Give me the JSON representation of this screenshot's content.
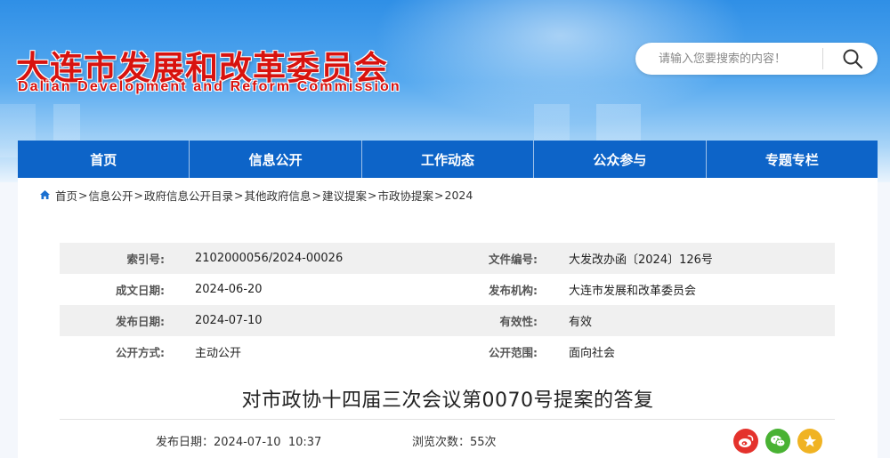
{
  "site": {
    "title_cn": "大连市发展和改革委员会",
    "title_en": "Dalian Development and Reform Commission"
  },
  "search": {
    "placeholder": "请输入您要搜索的内容！",
    "icon": "search-icon"
  },
  "nav": [
    {
      "label": "首页"
    },
    {
      "label": "信息公开"
    },
    {
      "label": "工作动态"
    },
    {
      "label": "公众参与"
    },
    {
      "label": "专题专栏"
    }
  ],
  "breadcrumb": [
    {
      "label": "首页"
    },
    {
      "label": "信息公开"
    },
    {
      "label": "政府信息公开目录"
    },
    {
      "label": "其他政府信息"
    },
    {
      "label": "建议提案"
    },
    {
      "label": "市政协提案"
    },
    {
      "label": "2024"
    }
  ],
  "breadcrumb_sep": ">",
  "meta": {
    "rows": [
      {
        "label1": "索引号:",
        "value1": "2102000056/2024-00026",
        "label2": "文件编号:",
        "value2": "大发改办函〔2024〕126号"
      },
      {
        "label1": "成文日期:",
        "value1": "2024-06-20",
        "label2": "发布机构:",
        "value2": "大连市发展和改革委员会"
      },
      {
        "label1": "发布日期:",
        "value1": "2024-07-10",
        "label2": "有效性:",
        "value2": "有效"
      },
      {
        "label1": "公开方式:",
        "value1": "主动公开",
        "label2": "公开范围:",
        "value2": "面向社会"
      }
    ]
  },
  "document": {
    "title": "对市政协十四届三次会议第0070号提案的答复",
    "publish_label": "发布日期：",
    "publish_value": "2024-07-10  10:37",
    "views_label": "浏览次数：",
    "views_value": "55次"
  },
  "share": [
    {
      "icon": "weibo-icon",
      "color": "#e4322c"
    },
    {
      "icon": "wechat-icon",
      "color": "#49b233"
    },
    {
      "icon": "star-icon",
      "color": "#f0b323"
    }
  ],
  "colors": {
    "brand_red": "#d8130f",
    "nav_blue": "#0d64c8"
  }
}
